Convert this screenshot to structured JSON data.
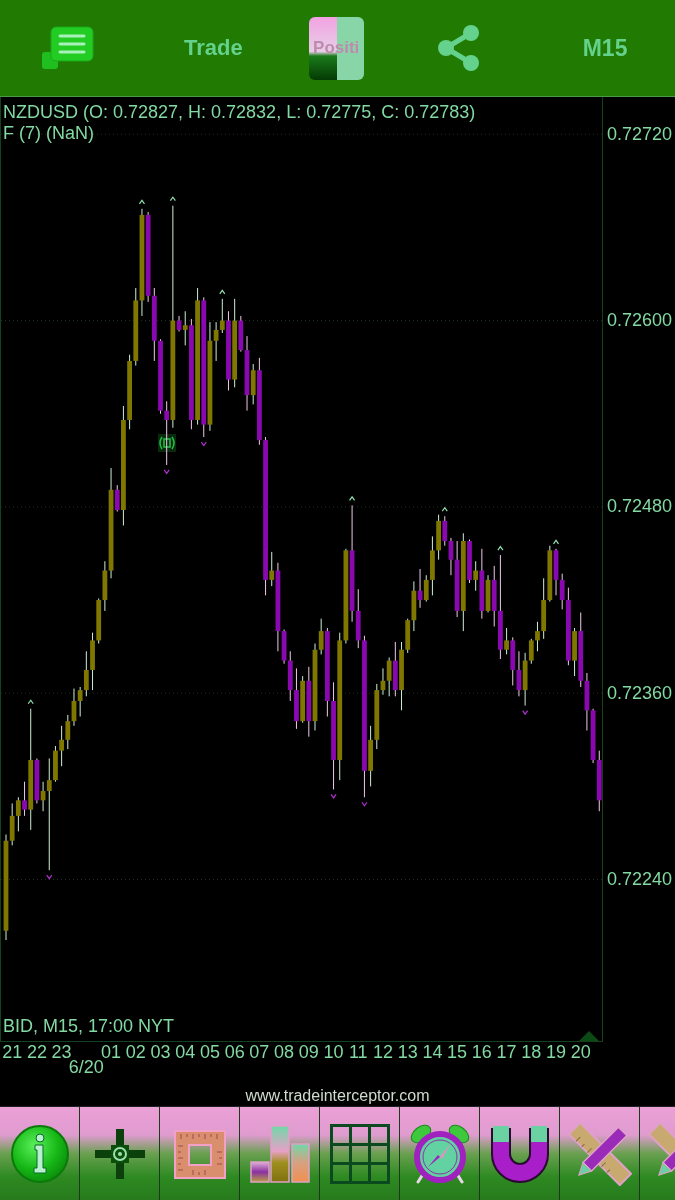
{
  "top_bar": {
    "trade_label": "Trade",
    "positions_label": "Positi",
    "timeframe_label": "M15"
  },
  "chart": {
    "quote": "NZDUSD (O: 0.72827, H: 0.72832, L: 0.72775, C: 0.72783)",
    "indicator": "F (7) (NaN)",
    "chart_data": {
      "type": "candlestick",
      "categories": [
        null,
        "21",
        null,
        null,
        null,
        "22",
        null,
        null,
        null,
        "23",
        null,
        null,
        null,
        "6/20",
        null,
        null,
        null,
        "01",
        null,
        null,
        null,
        "02",
        null,
        null,
        null,
        "03",
        null,
        null,
        null,
        "04",
        null,
        null,
        null,
        "05",
        null,
        null,
        null,
        "06",
        null,
        null,
        null,
        "07",
        null,
        null,
        null,
        "08",
        null,
        null,
        null,
        "09",
        null,
        null,
        null,
        "10",
        null,
        null,
        null,
        "11",
        null,
        null,
        null,
        "12",
        null,
        null,
        null,
        "13",
        null,
        null,
        null,
        "14",
        null,
        null,
        null,
        "15",
        null,
        null,
        null,
        "16",
        null,
        null,
        null,
        "17",
        null,
        null,
        null,
        "18",
        null,
        null,
        null,
        "19",
        null,
        null,
        null,
        "20",
        null,
        null,
        null
      ],
      "ohlc": [
        [
          0.72207,
          0.72269,
          0.72201,
          0.72265
        ],
        [
          0.72265,
          0.72289,
          0.72262,
          0.72281
        ],
        [
          0.72281,
          0.72293,
          0.72271,
          0.72291
        ],
        [
          0.72291,
          0.72303,
          0.72281,
          0.72285
        ],
        [
          0.72285,
          0.7235,
          0.72272,
          0.72317
        ],
        [
          0.72317,
          0.72318,
          0.72289,
          0.72291
        ],
        [
          0.72291,
          0.72303,
          0.72284,
          0.72297
        ],
        [
          0.72297,
          0.72318,
          0.72246,
          0.72304
        ],
        [
          0.72304,
          0.72326,
          0.72303,
          0.72323
        ],
        [
          0.72323,
          0.72339,
          0.72313,
          0.7233
        ],
        [
          0.7233,
          0.72346,
          0.72324,
          0.72342
        ],
        [
          0.72342,
          0.72363,
          0.72339,
          0.72355
        ],
        [
          0.72355,
          0.72364,
          0.72345,
          0.72362
        ],
        [
          0.72362,
          0.72387,
          0.72358,
          0.72375
        ],
        [
          0.72375,
          0.72399,
          0.72362,
          0.72394
        ],
        [
          0.72394,
          0.72421,
          0.72392,
          0.7242
        ],
        [
          0.7242,
          0.72445,
          0.72413,
          0.72439
        ],
        [
          0.72439,
          0.72505,
          0.72434,
          0.72491
        ],
        [
          0.72491,
          0.72494,
          0.72477,
          0.72478
        ],
        [
          0.72478,
          0.72545,
          0.72468,
          0.72536
        ],
        [
          0.72536,
          0.72578,
          0.7253,
          0.72574
        ],
        [
          0.72574,
          0.72621,
          0.72571,
          0.72613
        ],
        [
          0.72613,
          0.72672,
          0.72603,
          0.72668
        ],
        [
          0.72668,
          0.7267,
          0.72612,
          0.72616
        ],
        [
          0.72616,
          0.72621,
          0.72574,
          0.72587
        ],
        [
          0.72587,
          0.72588,
          0.7254,
          0.72542
        ],
        [
          0.72542,
          0.72548,
          0.72507,
          0.72536
        ],
        [
          0.72536,
          0.72674,
          0.72531,
          0.726
        ],
        [
          0.726,
          0.72603,
          0.72593,
          0.72594
        ],
        [
          0.72594,
          0.72606,
          0.72584,
          0.72597
        ],
        [
          0.72597,
          0.72601,
          0.7253,
          0.72536
        ],
        [
          0.72536,
          0.72621,
          0.72533,
          0.72613
        ],
        [
          0.72613,
          0.72615,
          0.72525,
          0.72533
        ],
        [
          0.72533,
          0.72599,
          0.72529,
          0.72587
        ],
        [
          0.72587,
          0.72599,
          0.72574,
          0.72594
        ],
        [
          0.72594,
          0.72614,
          0.72592,
          0.726
        ],
        [
          0.726,
          0.72606,
          0.72555,
          0.72562
        ],
        [
          0.72562,
          0.72614,
          0.72557,
          0.726
        ],
        [
          0.726,
          0.72603,
          0.7258,
          0.72581
        ],
        [
          0.72581,
          0.7259,
          0.72542,
          0.72552
        ],
        [
          0.72552,
          0.72572,
          0.72546,
          0.72568
        ],
        [
          0.72568,
          0.72576,
          0.7252,
          0.72523
        ],
        [
          0.72523,
          0.72525,
          0.72423,
          0.72433
        ],
        [
          0.72433,
          0.72451,
          0.72429,
          0.72439
        ],
        [
          0.72439,
          0.72444,
          0.72387,
          0.724
        ],
        [
          0.724,
          0.72401,
          0.72379,
          0.72381
        ],
        [
          0.72381,
          0.72387,
          0.72355,
          0.72362
        ],
        [
          0.72362,
          0.72376,
          0.72337,
          0.72342
        ],
        [
          0.72342,
          0.72371,
          0.72341,
          0.72368
        ],
        [
          0.72368,
          0.72377,
          0.72332,
          0.72342
        ],
        [
          0.72342,
          0.72392,
          0.72336,
          0.72388
        ],
        [
          0.72388,
          0.72408,
          0.72385,
          0.724
        ],
        [
          0.724,
          0.72402,
          0.72345,
          0.72355
        ],
        [
          0.72355,
          0.72367,
          0.72298,
          0.72317
        ],
        [
          0.72317,
          0.72399,
          0.72304,
          0.72394
        ],
        [
          0.72394,
          0.72453,
          0.72392,
          0.72452
        ],
        [
          0.72452,
          0.72481,
          0.72406,
          0.72413
        ],
        [
          0.72413,
          0.72427,
          0.72389,
          0.72394
        ],
        [
          0.72394,
          0.72397,
          0.72293,
          0.7231
        ],
        [
          0.7231,
          0.72339,
          0.723,
          0.7233
        ],
        [
          0.7233,
          0.72366,
          0.72324,
          0.72362
        ],
        [
          0.72362,
          0.72376,
          0.72359,
          0.72368
        ],
        [
          0.72368,
          0.72383,
          0.72358,
          0.72381
        ],
        [
          0.72381,
          0.72393,
          0.72358,
          0.72362
        ],
        [
          0.72362,
          0.72393,
          0.72349,
          0.72388
        ],
        [
          0.72388,
          0.72408,
          0.72386,
          0.72407
        ],
        [
          0.72407,
          0.72432,
          0.724,
          0.72426
        ],
        [
          0.72426,
          0.7244,
          0.72415,
          0.7242
        ],
        [
          0.7242,
          0.72436,
          0.72419,
          0.72433
        ],
        [
          0.72433,
          0.72461,
          0.72423,
          0.72452
        ],
        [
          0.72452,
          0.72475,
          0.72446,
          0.72471
        ],
        [
          0.72471,
          0.72474,
          0.72455,
          0.72458
        ],
        [
          0.72458,
          0.7246,
          0.72436,
          0.72446
        ],
        [
          0.72446,
          0.72458,
          0.72409,
          0.72413
        ],
        [
          0.72413,
          0.72463,
          0.724,
          0.72458
        ],
        [
          0.72458,
          0.72459,
          0.72431,
          0.72433
        ],
        [
          0.72433,
          0.72445,
          0.72426,
          0.72439
        ],
        [
          0.72439,
          0.72453,
          0.72408,
          0.72413
        ],
        [
          0.72413,
          0.72436,
          0.72412,
          0.72433
        ],
        [
          0.72433,
          0.72442,
          0.72403,
          0.72413
        ],
        [
          0.72413,
          0.72449,
          0.72382,
          0.72388
        ],
        [
          0.72388,
          0.72402,
          0.72385,
          0.72394
        ],
        [
          0.72394,
          0.72396,
          0.72365,
          0.72375
        ],
        [
          0.72375,
          0.72387,
          0.72358,
          0.72362
        ],
        [
          0.72362,
          0.72386,
          0.72352,
          0.72381
        ],
        [
          0.72381,
          0.72395,
          0.72379,
          0.72394
        ],
        [
          0.72394,
          0.72406,
          0.72387,
          0.724
        ],
        [
          0.724,
          0.72434,
          0.72395,
          0.7242
        ],
        [
          0.7242,
          0.72455,
          0.72419,
          0.72452
        ],
        [
          0.72452,
          0.72453,
          0.72423,
          0.72433
        ],
        [
          0.72433,
          0.72437,
          0.72414,
          0.7242
        ],
        [
          0.7242,
          0.72428,
          0.72378,
          0.72381
        ],
        [
          0.72381,
          0.72402,
          0.72371,
          0.724
        ],
        [
          0.724,
          0.72412,
          0.72364,
          0.72368
        ],
        [
          0.72368,
          0.72373,
          0.72336,
          0.72349
        ],
        [
          0.72349,
          0.7235,
          0.72315,
          0.72317
        ],
        [
          0.72317,
          0.72323,
          0.72284,
          0.72291
        ]
      ],
      "ylim": [
        0.72136,
        0.72744
      ],
      "yticks": [
        {
          "value": 0.7272,
          "label": "0.72720"
        },
        {
          "value": 0.726,
          "label": "0.72600"
        },
        {
          "value": 0.7248,
          "label": "0.72480"
        },
        {
          "value": 0.7236,
          "label": "0.72360"
        },
        {
          "value": 0.7224,
          "label": "0.72240"
        }
      ],
      "grid": true
    },
    "info": "BID, M15, 17:00 NYT"
  },
  "footer": {
    "website": "www.tradeinterceptor.com"
  }
}
